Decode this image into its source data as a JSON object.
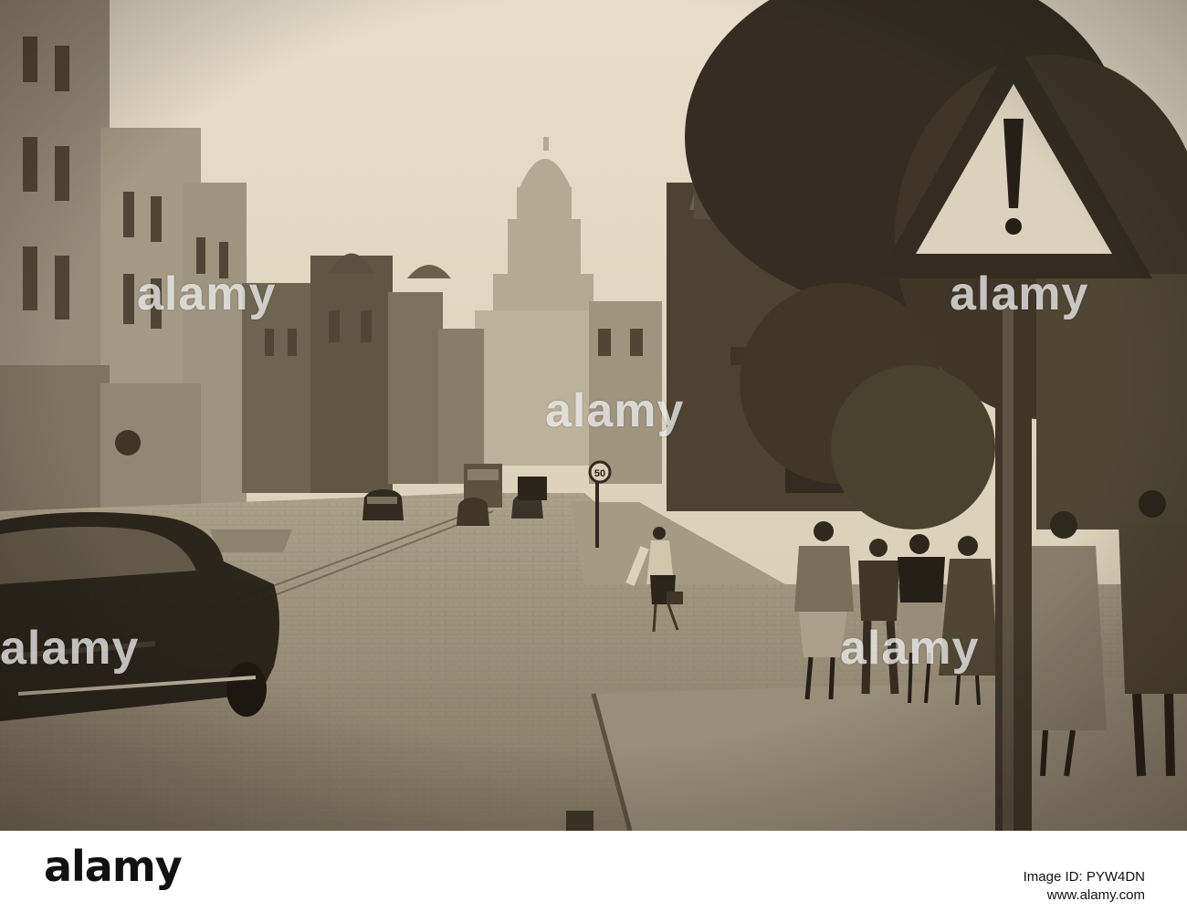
{
  "photo": {
    "sign_symbol": "exclamation-warning",
    "speed_sign": "50",
    "palette": {
      "sky": "#e9e3cf",
      "stone": "#8b8170",
      "dark": "#2b261d",
      "paper": "#d9d1bb"
    }
  },
  "watermarks": {
    "center": "alamy",
    "top_left": "alamy",
    "top_right": "alamy",
    "bottom_left": "alamy",
    "bottom_right": "alamy"
  },
  "footer": {
    "logo": "alamy",
    "image_id": "Image ID: PYW4DN",
    "site": "www.alamy.com"
  }
}
